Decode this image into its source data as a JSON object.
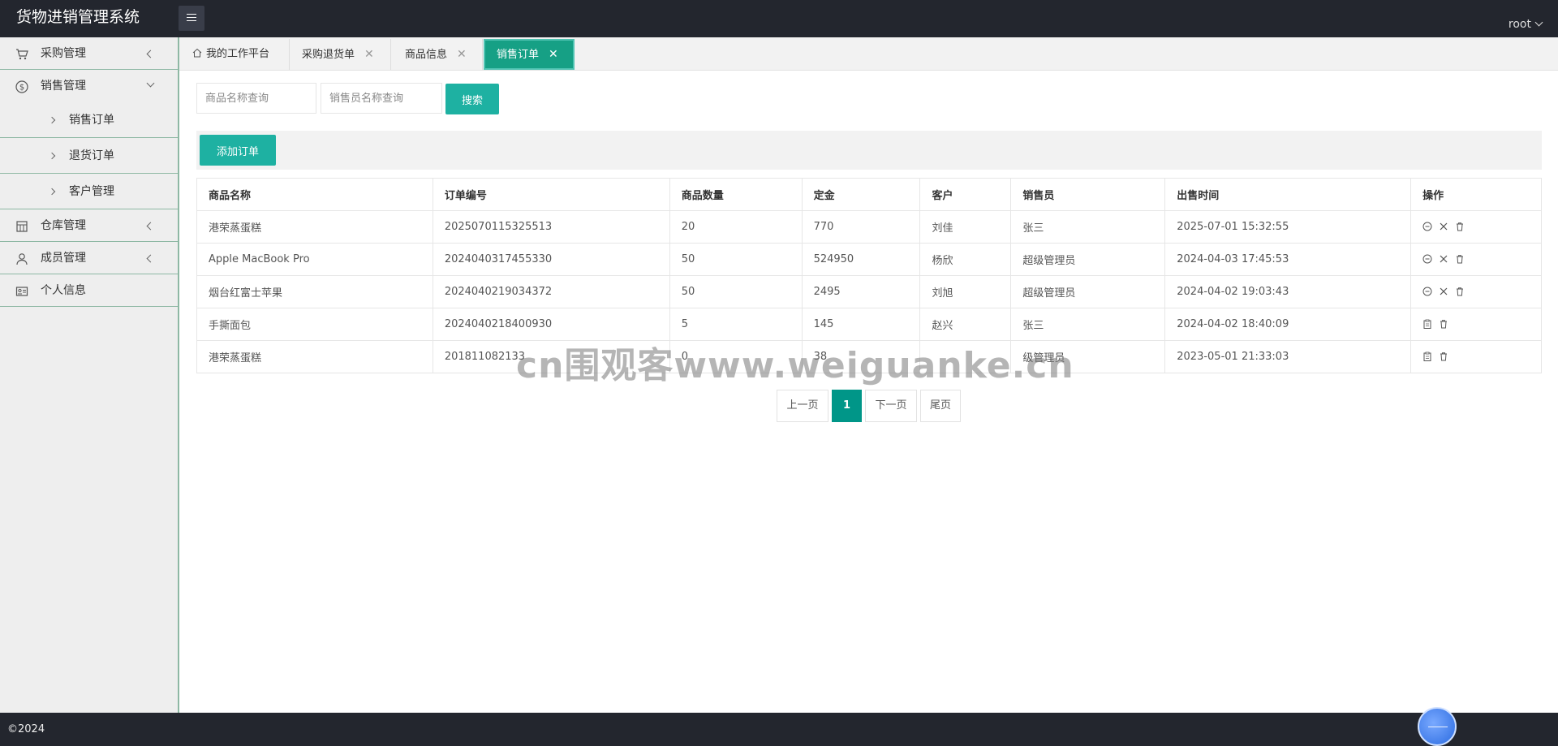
{
  "app": {
    "title": "货物进销管理系统",
    "user": "root"
  },
  "sidebar": {
    "items": [
      {
        "label": "采购管理",
        "icon": "cart-icon",
        "state": "collapsed"
      },
      {
        "label": "销售管理",
        "icon": "dollar-icon",
        "state": "expanded",
        "children": [
          {
            "label": "销售订单"
          },
          {
            "label": "退货订单"
          },
          {
            "label": "客户管理"
          }
        ]
      },
      {
        "label": "仓库管理",
        "icon": "warehouse-icon",
        "state": "collapsed"
      },
      {
        "label": "成员管理",
        "icon": "user-icon",
        "state": "collapsed"
      },
      {
        "label": "个人信息",
        "icon": "id-card-icon"
      }
    ]
  },
  "tabs": [
    {
      "label": "我的工作平台",
      "closable": false
    },
    {
      "label": "采购退货单",
      "closable": true
    },
    {
      "label": "商品信息",
      "closable": true
    },
    {
      "label": "销售订单",
      "closable": true,
      "active": true
    }
  ],
  "search": {
    "product_placeholder": "商品名称查询",
    "seller_placeholder": "销售员名称查询",
    "button": "搜索"
  },
  "toolbar": {
    "add_label": "添加订单"
  },
  "table": {
    "columns": [
      "商品名称",
      "订单编号",
      "商品数量",
      "定金",
      "客户",
      "销售员",
      "出售时间",
      "操作"
    ],
    "rows": [
      {
        "product": "港荣蒸蛋糕",
        "order_no": "2025070115325513",
        "qty": "20",
        "deposit": "770",
        "customer": "刘佳",
        "seller": "张三",
        "time": "2025-07-01 15:32:55"
      },
      {
        "product": "Apple MacBook Pro",
        "order_no": "2024040317455330",
        "qty": "50",
        "deposit": "524950",
        "customer": "杨欣",
        "seller": "超级管理员",
        "time": "2024-04-03 17:45:53"
      },
      {
        "product": "烟台红富士苹果",
        "order_no": "2024040219034372",
        "qty": "50",
        "deposit": "2495",
        "customer": "刘旭",
        "seller": "超级管理员",
        "time": "2024-04-02 19:03:43"
      },
      {
        "product": "手撕面包",
        "order_no": "2024040218400930",
        "qty": "5",
        "deposit": "145",
        "customer": "赵兴",
        "seller": "张三",
        "time": "2024-04-02 18:40:09"
      },
      {
        "product": "港荣蒸蛋糕",
        "order_no": "201811082133",
        "qty": "0",
        "deposit": "38",
        "customer": "",
        "seller": "级管理员",
        "time": "2023-05-01 21:33:03"
      }
    ]
  },
  "pagination": {
    "prev": "上一页",
    "current": "1",
    "next": "下一页",
    "last": "尾页"
  },
  "watermark": "cn围观客www.weiguanke.cn",
  "footer": {
    "copyright": "©2024"
  },
  "colors": {
    "header": "#23262e",
    "accent": "#1eb1a2",
    "sidebar_border": "#8eb8a4"
  }
}
